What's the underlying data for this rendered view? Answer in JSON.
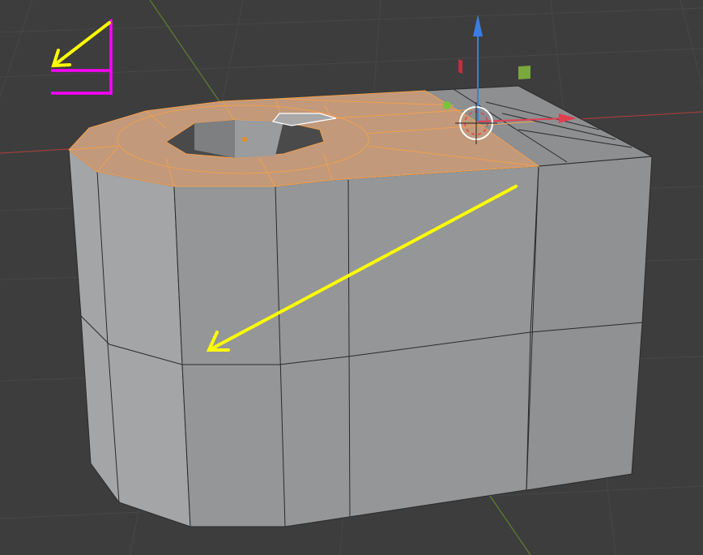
{
  "viewport": {
    "colors": {
      "background": "#3d3d3d",
      "grid": "#484848",
      "x_axis": "#a04040",
      "y_axis": "#5e7a32",
      "mesh_face": "#9a9c9e",
      "mesh_edge": "#2a2a2a",
      "selected_face": "#c8936a",
      "selected_edge": "#f0a050",
      "annotation_arrow": "#ffff00",
      "annotation_marker": "#ff00ff"
    },
    "icons": [
      "move-gizmo-icon",
      "3d-cursor-icon",
      "arrow-annotation-icon",
      "bracket-marker-icon"
    ]
  }
}
